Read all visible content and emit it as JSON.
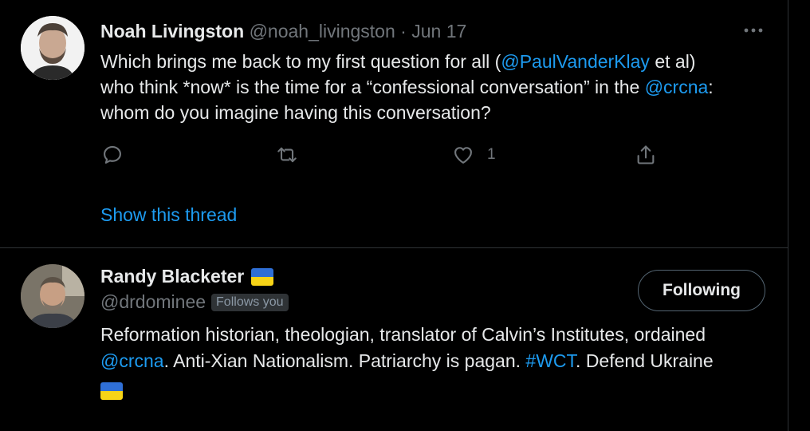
{
  "tweet": {
    "author_name": "Noah Livingston",
    "author_handle": "@noah_livingston",
    "separator": "·",
    "date": "Jun 17",
    "text": {
      "line1_pre": "Which brings me back to my first question for all (",
      "line1_mention": "@PaulVanderKlay",
      "line1_post": " et al)",
      "line2_pre": "who think *now* is the time for a “confessional conversation” in the ",
      "line2_mention": "@crcna",
      "line2_post": ":",
      "line3": "whom do you imagine having this conversation?"
    },
    "actions": {
      "reply_icon": "reply-icon",
      "retweet_icon": "retweet-icon",
      "like_icon": "like-icon",
      "like_count": "1",
      "share_icon": "share-icon"
    },
    "more_icon": "more-icon",
    "show_thread": "Show this thread"
  },
  "profile": {
    "name": "Randy Blacketer",
    "flag_icon": "ukraine-flag-icon",
    "handle": "@drdominee",
    "follows_badge": "Follows you",
    "follow_button": "Following",
    "bio": {
      "line1": "Reformation historian, theologian, translator of Calvin’s Institutes, ordained",
      "line2_mention": "@crcna",
      "line2_mid": ". Anti-Xian Nationalism. Patriarchy is pagan. ",
      "line2_hashtag": "#WCT",
      "line2_post": ". Defend Ukraine"
    }
  },
  "colors": {
    "background": "#000000",
    "text": "#e7e9ea",
    "muted": "#71767b",
    "link": "#1d9bf0",
    "border": "#2f3336",
    "flag_blue": "#2f6fd6",
    "flag_yellow": "#f7d417"
  }
}
